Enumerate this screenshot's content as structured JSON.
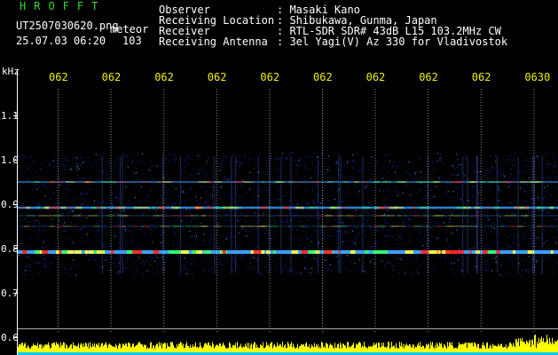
{
  "header": {
    "app_name": "HROFFT",
    "filename": "UT2507030620.png",
    "detection_label": "meteor",
    "datetime": "25.07.03 06:20",
    "detection_count": "103",
    "fields": [
      {
        "label": "Observer",
        "value": ": Masaki Kano"
      },
      {
        "label": "Receiving Location",
        "value": ": Shibukawa, Gunma, Japan"
      },
      {
        "label": "Receiver",
        "value": ": RTL-SDR SDR# 43dB L15 103.2MHz CW"
      },
      {
        "label": "Receiving Antenna",
        "value": ": 3el Yagi(V) Az 330 for Vladivostok"
      }
    ]
  },
  "spectrogram": {
    "freq_unit": "kHz",
    "freq_ticks": [
      "1.1",
      "1.0",
      "0.9",
      "0.8",
      "0.7",
      "0.6"
    ],
    "time_ticks": [
      "062",
      "062",
      "062",
      "062",
      "062",
      "062",
      "062",
      "062",
      "062",
      "0630"
    ],
    "colors": {
      "background": "#000000",
      "axis": "#ffffff",
      "time_label": "#f0f000",
      "header_text": "#ffffff",
      "app_name": "#33dd33",
      "noise": "#1a2fd8",
      "signal_hot": "#ff2020",
      "power_bar": "#ffff00",
      "power_baseline": "#00c8ff"
    }
  }
}
